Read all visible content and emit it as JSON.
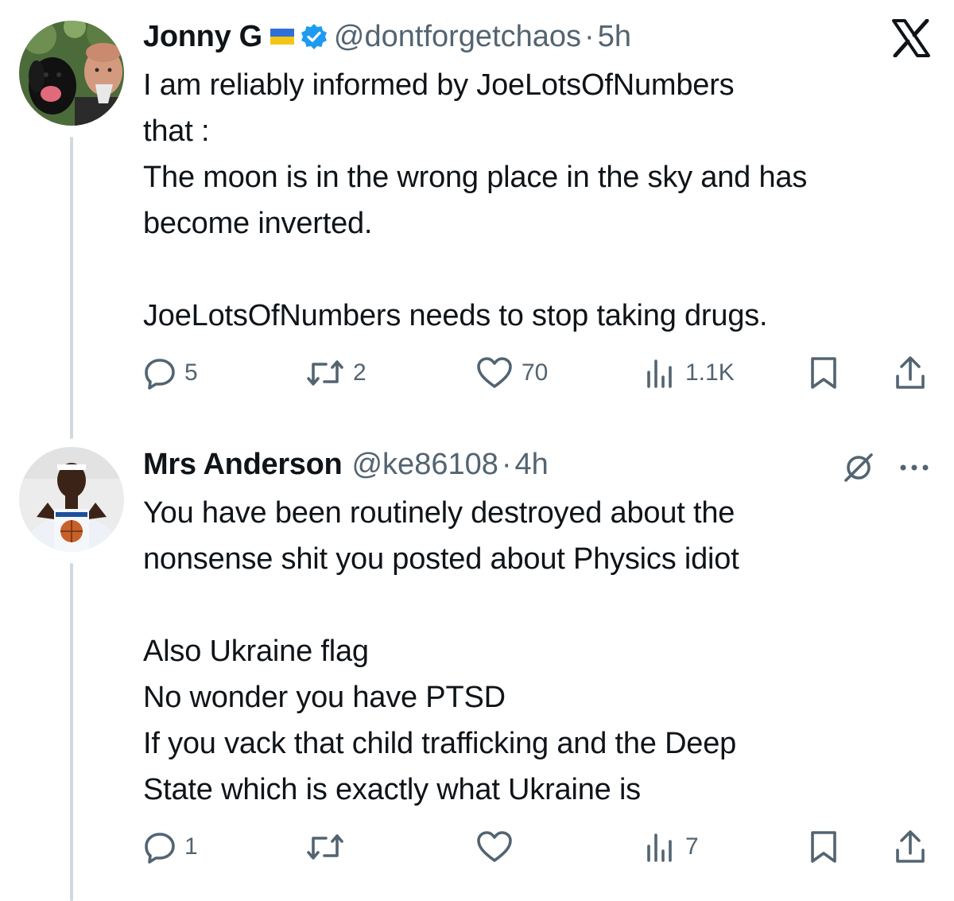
{
  "tweets": [
    {
      "name": "Jonny G",
      "handle": "@dontforgetchaos",
      "separator": "·",
      "time": "5h",
      "flag_colors": {
        "top": "#2f6fd8",
        "bottom": "#f4c514"
      },
      "verified": true,
      "text": "I am reliably informed by JoeLotsOfNumbers\nthat :\nThe moon is in the wrong place in the sky and has\nbecome inverted.\n\nJoeLotsOfNumbers needs to stop taking drugs.",
      "actions": {
        "replies": "5",
        "reposts": "2",
        "likes": "70",
        "views": "1.1K"
      },
      "icons": [
        "reply-icon",
        "repost-icon",
        "like-icon",
        "views-icon",
        "bookmark-icon",
        "share-icon"
      ]
    },
    {
      "name": "Mrs Anderson",
      "handle": "@ke86108",
      "separator": "·",
      "time": "4h",
      "text": "You have been routinely destroyed about the\nnonsense shit you posted about Physics idiot\n\nAlso Ukraine flag\nNo wonder you have PTSD\nIf you vack that child trafficking and the Deep\nState which is exactly what Ukraine is",
      "actions": {
        "replies": "1",
        "reposts": "",
        "likes": "",
        "views": "7"
      },
      "icons": [
        "grok-icon",
        "more-icon",
        "reply-icon",
        "repost-icon",
        "like-icon",
        "views-icon",
        "bookmark-icon",
        "share-icon"
      ]
    }
  ],
  "brand": {
    "logo": "x-logo-icon",
    "verified_color": "#1d9bf0",
    "thread_line_color": "#cfd9de",
    "secondary_text_color": "#536471"
  }
}
